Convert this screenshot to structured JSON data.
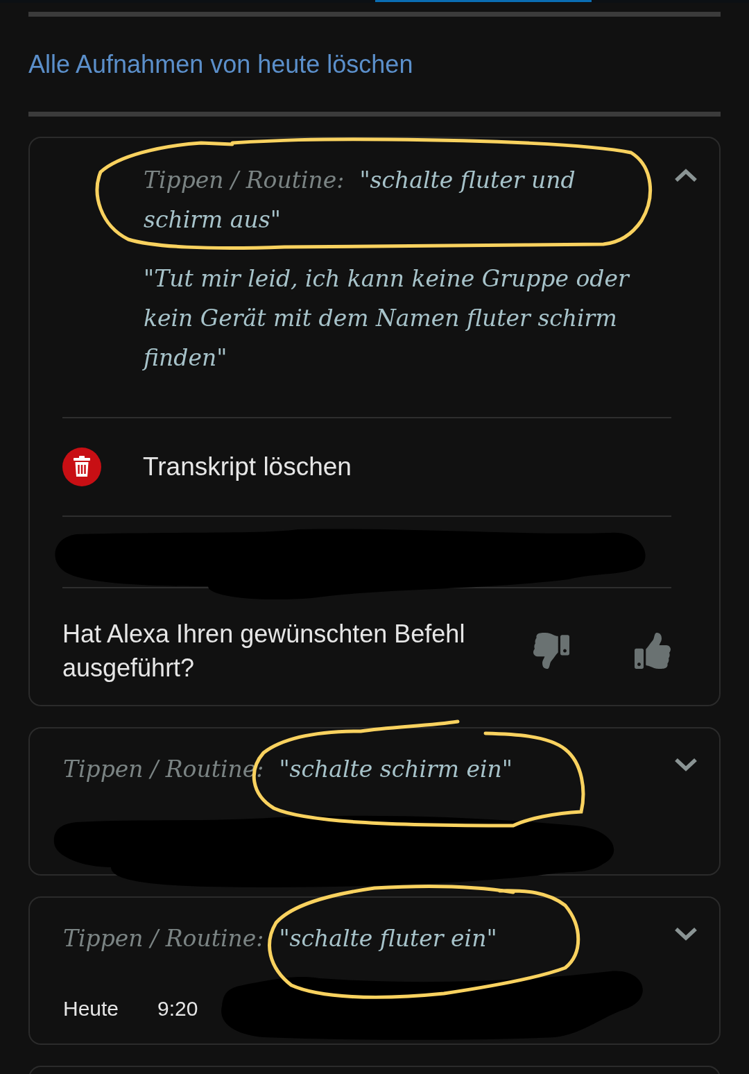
{
  "header": {
    "delete_all_link": "Alle Aufnahmen von heute löschen"
  },
  "entries": [
    {
      "source": "Tippen / Routine:",
      "utterance": "\"schalte fluter und schirm aus\"",
      "expanded": true,
      "response": "\"Tut mir leid, ich kann keine Gruppe oder kein Gerät mit dem Namen fluter schirm finden\"",
      "actions": [
        {
          "label": "Transkript löschen"
        }
      ],
      "feedback_question": "Hat Alexa Ihren gewünschten Befehl ausgeführt?"
    },
    {
      "source": "Tippen / Routine:",
      "utterance": "\"schalte schirm ein\"",
      "expanded": false
    },
    {
      "source": "Tippen / Routine:",
      "utterance": "\"schalte fluter ein\"",
      "expanded": false,
      "date": "Heute",
      "time": "9:20"
    }
  ]
}
